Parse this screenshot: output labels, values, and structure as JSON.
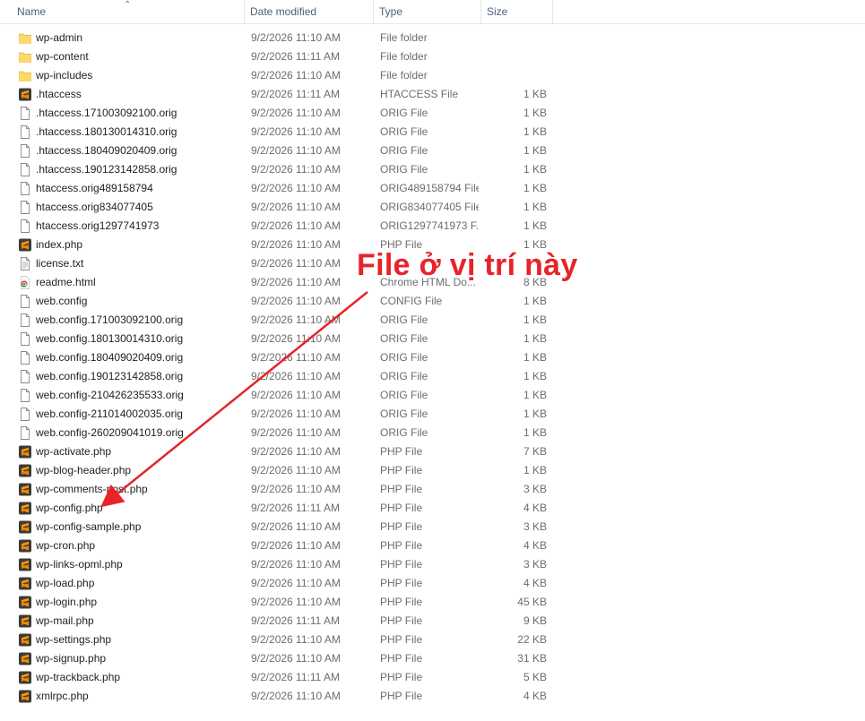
{
  "columns": {
    "name": "Name",
    "date": "Date modified",
    "type": "Type",
    "size": "Size"
  },
  "annotation": {
    "text": "File ở vị trí này",
    "color": "#e8232a"
  },
  "files": [
    {
      "name": "wp-admin",
      "date": "9/2/2026 11:10 AM",
      "type": "File folder",
      "size": "",
      "icon": "folder-icon"
    },
    {
      "name": "wp-content",
      "date": "9/2/2026 11:11 AM",
      "type": "File folder",
      "size": "",
      "icon": "folder-icon"
    },
    {
      "name": "wp-includes",
      "date": "9/2/2026 11:10 AM",
      "type": "File folder",
      "size": "",
      "icon": "folder-icon"
    },
    {
      "name": ".htaccess",
      "date": "9/2/2026 11:11 AM",
      "type": "HTACCESS File",
      "size": "1 KB",
      "icon": "sublime-text-icon"
    },
    {
      "name": ".htaccess.171003092100.orig",
      "date": "9/2/2026 11:10 AM",
      "type": "ORIG File",
      "size": "1 KB",
      "icon": "file-icon"
    },
    {
      "name": ".htaccess.180130014310.orig",
      "date": "9/2/2026 11:10 AM",
      "type": "ORIG File",
      "size": "1 KB",
      "icon": "file-icon"
    },
    {
      "name": ".htaccess.180409020409.orig",
      "date": "9/2/2026 11:10 AM",
      "type": "ORIG File",
      "size": "1 KB",
      "icon": "file-icon"
    },
    {
      "name": ".htaccess.190123142858.orig",
      "date": "9/2/2026 11:10 AM",
      "type": "ORIG File",
      "size": "1 KB",
      "icon": "file-icon"
    },
    {
      "name": "htaccess.orig489158794",
      "date": "9/2/2026 11:10 AM",
      "type": "ORIG489158794 File",
      "size": "1 KB",
      "icon": "file-icon"
    },
    {
      "name": "htaccess.orig834077405",
      "date": "9/2/2026 11:10 AM",
      "type": "ORIG834077405 File",
      "size": "1 KB",
      "icon": "file-icon"
    },
    {
      "name": "htaccess.orig1297741973",
      "date": "9/2/2026 11:10 AM",
      "type": "ORIG1297741973 F...",
      "size": "1 KB",
      "icon": "file-icon"
    },
    {
      "name": "index.php",
      "date": "9/2/2026 11:10 AM",
      "type": "PHP File",
      "size": "1 KB",
      "icon": "sublime-text-icon"
    },
    {
      "name": "license.txt",
      "date": "9/2/2026 11:10 AM",
      "type": "",
      "size": "",
      "icon": "text-file-icon"
    },
    {
      "name": "readme.html",
      "date": "9/2/2026 11:10 AM",
      "type": "Chrome HTML Do...",
      "size": "8 KB",
      "icon": "chrome-icon"
    },
    {
      "name": "web.config",
      "date": "9/2/2026 11:10 AM",
      "type": "CONFIG File",
      "size": "1 KB",
      "icon": "file-icon"
    },
    {
      "name": "web.config.171003092100.orig",
      "date": "9/2/2026 11:10 AM",
      "type": "ORIG File",
      "size": "1 KB",
      "icon": "file-icon"
    },
    {
      "name": "web.config.180130014310.orig",
      "date": "9/2/2026 11:10 AM",
      "type": "ORIG File",
      "size": "1 KB",
      "icon": "file-icon"
    },
    {
      "name": "web.config.180409020409.orig",
      "date": "9/2/2026 11:10 AM",
      "type": "ORIG File",
      "size": "1 KB",
      "icon": "file-icon"
    },
    {
      "name": "web.config.190123142858.orig",
      "date": "9/2/2026 11:10 AM",
      "type": "ORIG File",
      "size": "1 KB",
      "icon": "file-icon"
    },
    {
      "name": "web.config-210426235533.orig",
      "date": "9/2/2026 11:10 AM",
      "type": "ORIG File",
      "size": "1 KB",
      "icon": "file-icon"
    },
    {
      "name": "web.config-211014002035.orig",
      "date": "9/2/2026 11:10 AM",
      "type": "ORIG File",
      "size": "1 KB",
      "icon": "file-icon"
    },
    {
      "name": "web.config-260209041019.orig",
      "date": "9/2/2026 11:10 AM",
      "type": "ORIG File",
      "size": "1 KB",
      "icon": "file-icon"
    },
    {
      "name": "wp-activate.php",
      "date": "9/2/2026 11:10 AM",
      "type": "PHP File",
      "size": "7 KB",
      "icon": "sublime-text-icon"
    },
    {
      "name": "wp-blog-header.php",
      "date": "9/2/2026 11:10 AM",
      "type": "PHP File",
      "size": "1 KB",
      "icon": "sublime-text-icon"
    },
    {
      "name": "wp-comments-post.php",
      "date": "9/2/2026 11:10 AM",
      "type": "PHP File",
      "size": "3 KB",
      "icon": "sublime-text-icon"
    },
    {
      "name": "wp-config.php",
      "date": "9/2/2026 11:11 AM",
      "type": "PHP File",
      "size": "4 KB",
      "icon": "sublime-text-icon"
    },
    {
      "name": "wp-config-sample.php",
      "date": "9/2/2026 11:10 AM",
      "type": "PHP File",
      "size": "3 KB",
      "icon": "sublime-text-icon"
    },
    {
      "name": "wp-cron.php",
      "date": "9/2/2026 11:10 AM",
      "type": "PHP File",
      "size": "4 KB",
      "icon": "sublime-text-icon"
    },
    {
      "name": "wp-links-opml.php",
      "date": "9/2/2026 11:10 AM",
      "type": "PHP File",
      "size": "3 KB",
      "icon": "sublime-text-icon"
    },
    {
      "name": "wp-load.php",
      "date": "9/2/2026 11:10 AM",
      "type": "PHP File",
      "size": "4 KB",
      "icon": "sublime-text-icon"
    },
    {
      "name": "wp-login.php",
      "date": "9/2/2026 11:10 AM",
      "type": "PHP File",
      "size": "45 KB",
      "icon": "sublime-text-icon"
    },
    {
      "name": "wp-mail.php",
      "date": "9/2/2026 11:11 AM",
      "type": "PHP File",
      "size": "9 KB",
      "icon": "sublime-text-icon"
    },
    {
      "name": "wp-settings.php",
      "date": "9/2/2026 11:10 AM",
      "type": "PHP File",
      "size": "22 KB",
      "icon": "sublime-text-icon"
    },
    {
      "name": "wp-signup.php",
      "date": "9/2/2026 11:10 AM",
      "type": "PHP File",
      "size": "31 KB",
      "icon": "sublime-text-icon"
    },
    {
      "name": "wp-trackback.php",
      "date": "9/2/2026 11:11 AM",
      "type": "PHP File",
      "size": "5 KB",
      "icon": "sublime-text-icon"
    },
    {
      "name": "xmlrpc.php",
      "date": "9/2/2026 11:10 AM",
      "type": "PHP File",
      "size": "4 KB",
      "icon": "sublime-text-icon"
    }
  ]
}
